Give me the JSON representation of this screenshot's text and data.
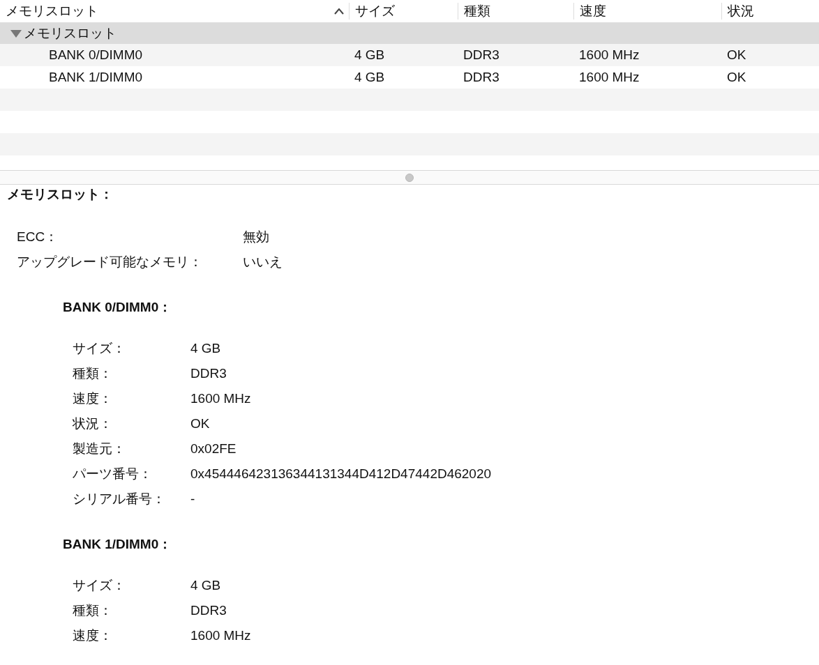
{
  "table": {
    "columns": [
      {
        "label": "メモリスロット",
        "sorted": true
      },
      {
        "label": "サイズ",
        "sorted": false
      },
      {
        "label": "種類",
        "sorted": false
      },
      {
        "label": "速度",
        "sorted": false
      },
      {
        "label": "状況",
        "sorted": false
      }
    ],
    "group": {
      "label": "メモリスロット",
      "expanded": true,
      "rows": [
        {
          "cells": [
            "BANK 0/DIMM0",
            "4 GB",
            "DDR3",
            "1600 MHz",
            "OK"
          ]
        },
        {
          "cells": [
            "BANK 1/DIMM0",
            "4 GB",
            "DDR3",
            "1600 MHz",
            "OK"
          ]
        }
      ]
    }
  },
  "detail": {
    "title": "メモリスロット：",
    "properties": [
      {
        "label": "ECC：",
        "value": "無効"
      },
      {
        "label": "アップグレード可能なメモリ：",
        "value": "いいえ"
      }
    ],
    "banks": [
      {
        "title": "BANK 0/DIMM0：",
        "properties": [
          {
            "label": "サイズ：",
            "value": "4 GB"
          },
          {
            "label": "種類：",
            "value": "DDR3"
          },
          {
            "label": "速度：",
            "value": "1600 MHz"
          },
          {
            "label": "状況：",
            "value": "OK"
          },
          {
            "label": "製造元：",
            "value": "0x02FE"
          },
          {
            "label": "パーツ番号：",
            "value": "0x454446423136344131344D412D47442D462020"
          },
          {
            "label": "シリアル番号：",
            "value": "-"
          }
        ]
      },
      {
        "title": "BANK 1/DIMM0：",
        "properties": [
          {
            "label": "サイズ：",
            "value": "4 GB"
          },
          {
            "label": "種類：",
            "value": "DDR3"
          },
          {
            "label": "速度：",
            "value": "1600 MHz"
          }
        ]
      }
    ]
  }
}
